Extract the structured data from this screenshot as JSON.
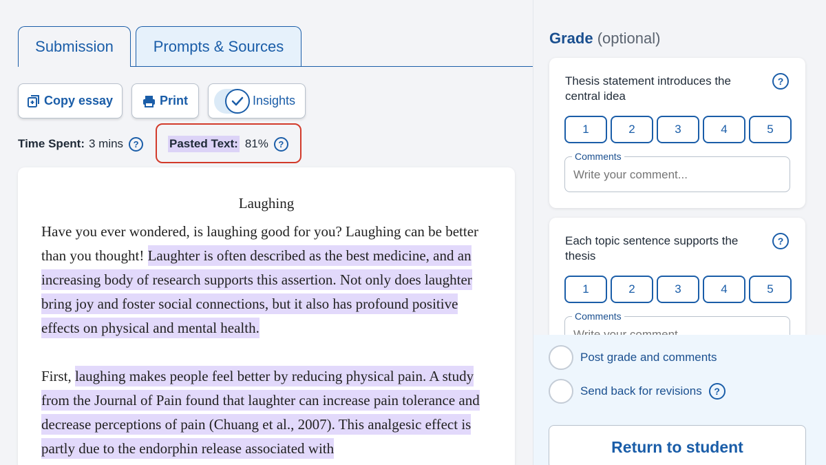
{
  "tabs": {
    "submission": "Submission",
    "prompts_sources": "Prompts & Sources"
  },
  "toolbar": {
    "copy_label": "Copy essay",
    "print_label": "Print",
    "insights_label": "Insights",
    "insights_enabled": true
  },
  "meta": {
    "time_spent_label": "Time Spent:",
    "time_spent_value": "3 mins",
    "pasted_label": "Pasted Text:",
    "pasted_value": "81%"
  },
  "essay": {
    "title": "Laughing",
    "p1_plain": "Have you ever wondered, is laughing good for you? Laughing can be better than you thought! ",
    "p1_pasted": "Laughter is often described as the best medicine, and an increasing body of research supports this assertion. Not only does laughter bring joy and foster social connections, but it also has profound positive effects on physical and mental health.",
    "p2_plain": "First, ",
    "p2_pasted": "laughing makes people feel better by reducing physical pain. A study from the Journal of Pain found that laughter can increase pain tolerance and decrease perceptions of pain (Chuang et al., 2007). This analgesic effect is partly due to the endorphin release associated with"
  },
  "grade": {
    "title": "Grade",
    "optional": "(optional)",
    "criteria": [
      {
        "text": "Thesis statement introduces the central idea",
        "scores": [
          "1",
          "2",
          "3",
          "4",
          "5"
        ],
        "comment_label": "Comments",
        "comment_placeholder": "Write your comment..."
      },
      {
        "text": "Each topic sentence supports the thesis",
        "scores": [
          "1",
          "2",
          "3",
          "4",
          "5"
        ],
        "comment_label": "Comments",
        "comment_placeholder": "Write your comment..."
      }
    ]
  },
  "actions": {
    "post_label": "Post grade and comments",
    "send_back_label": "Send back for revisions",
    "return_label": "Return to student"
  },
  "icons": {
    "help": "?",
    "accent_color": "#1a5da8",
    "highlight_color": "#e2d9fb",
    "alert_outline_color": "#d23a2a"
  }
}
